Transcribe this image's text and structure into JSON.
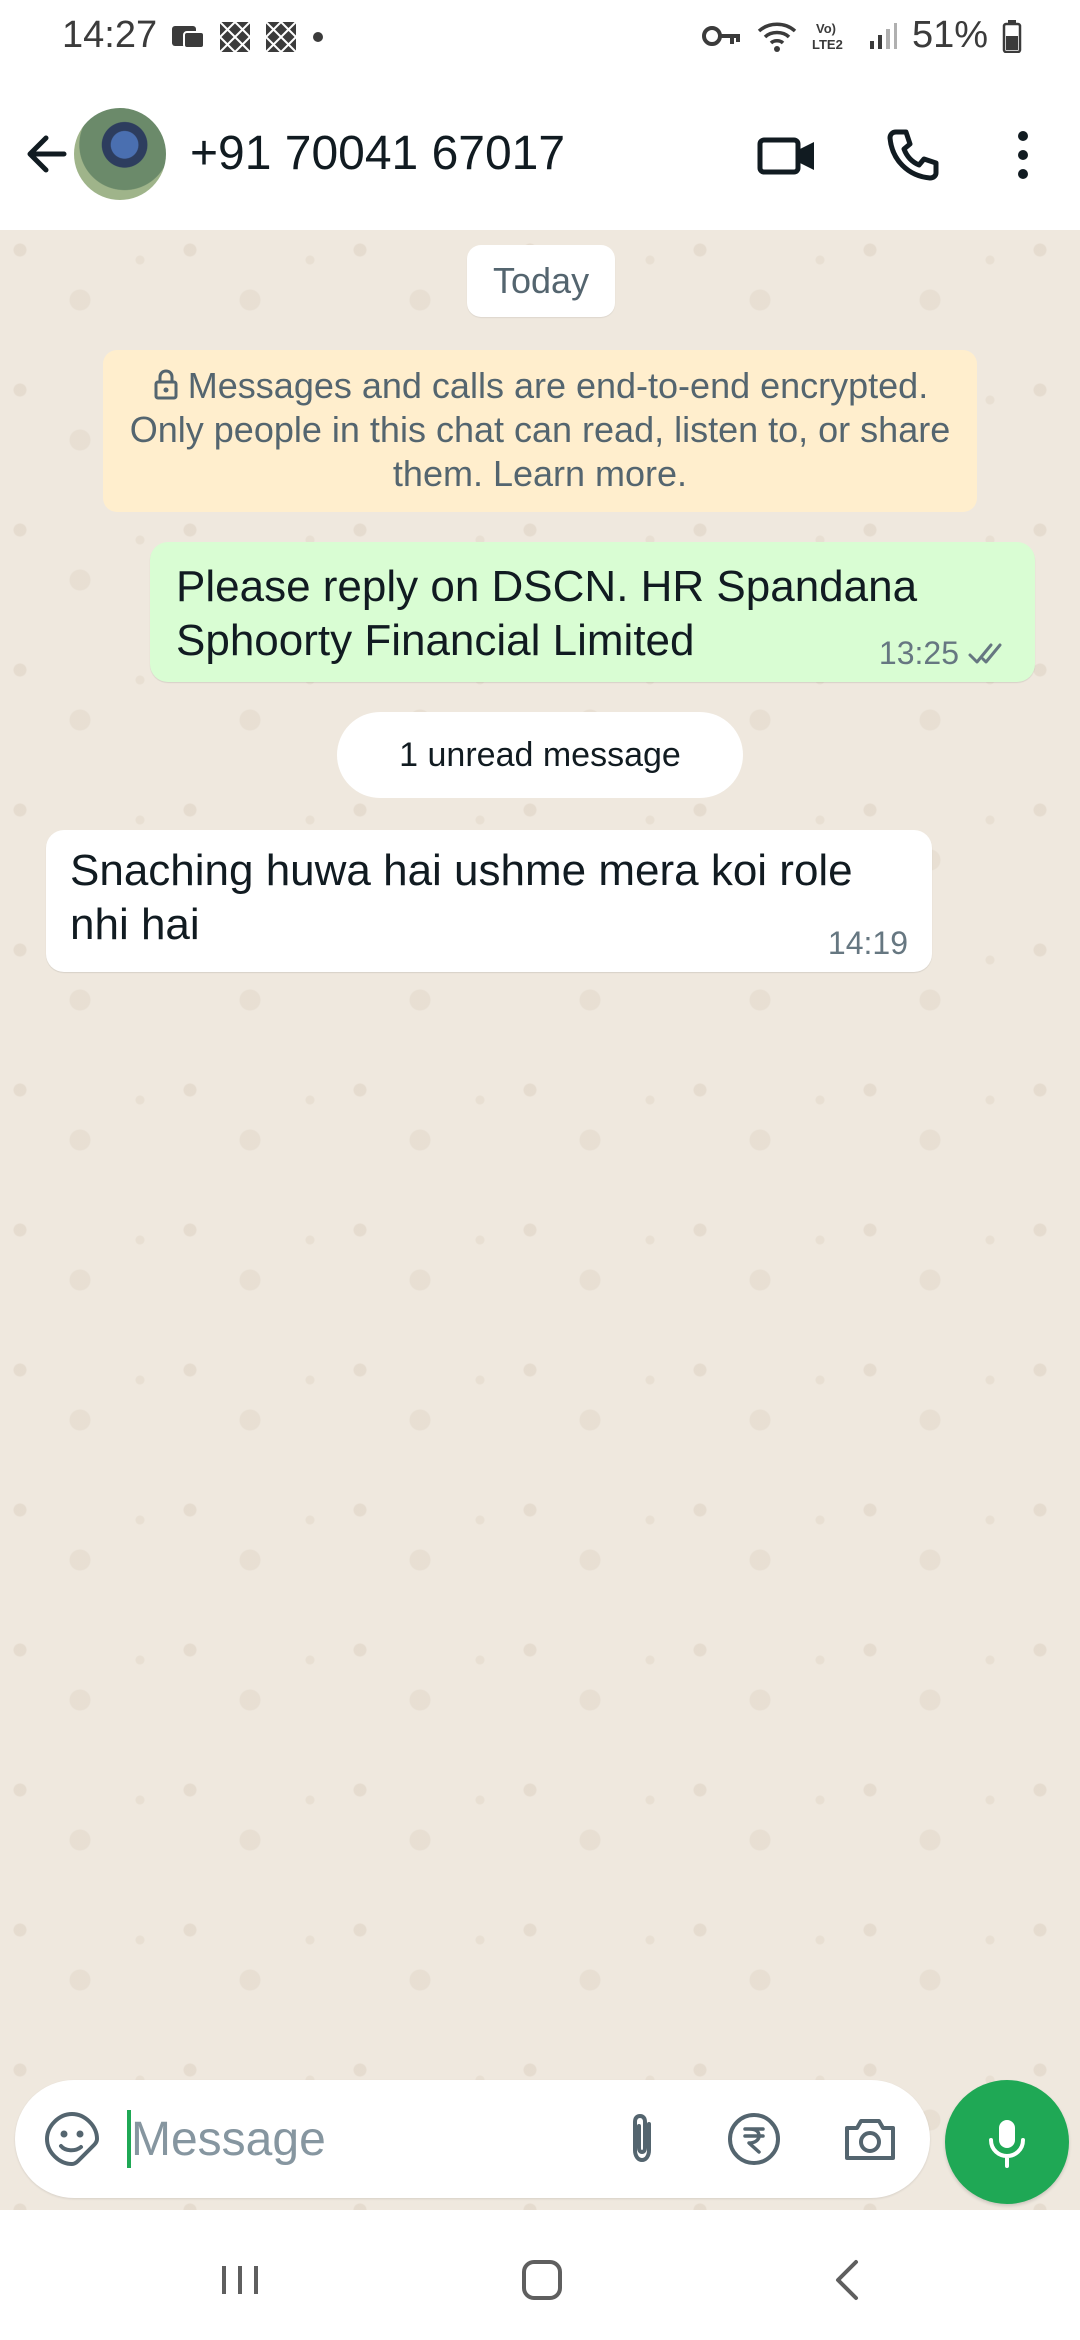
{
  "status_bar": {
    "time": "14:27",
    "battery": "51%",
    "icons": [
      "key-icon",
      "wifi-icon",
      "volte-icon",
      "signal-icon",
      "battery-icon"
    ]
  },
  "header": {
    "contact_name": "+91 70041 67017",
    "icons": [
      "back-arrow-icon",
      "video-call-icon",
      "voice-call-icon",
      "more-options-icon"
    ]
  },
  "chat": {
    "date_label": "Today",
    "encryption_notice": "Messages and calls are end-to-end encrypted. Only people in this chat can read, listen to, or share them. Learn more.",
    "messages": [
      {
        "direction": "outgoing",
        "text": "Please reply on DSCN. HR Spandana Sphoorty Financial Limited",
        "time": "13:25",
        "status": "read"
      },
      {
        "direction": "incoming",
        "text": "Snaching huwa hai ushme mera koi role nhi hai",
        "time": "14:19"
      }
    ],
    "unread_label": "1 unread message"
  },
  "composer": {
    "placeholder": "Message",
    "value": ""
  },
  "colors": {
    "accent": "#1fa855",
    "outgoing_bubble": "#d9fdd3",
    "chat_background": "#efe8de",
    "encryption_bg": "#ffeecd"
  }
}
